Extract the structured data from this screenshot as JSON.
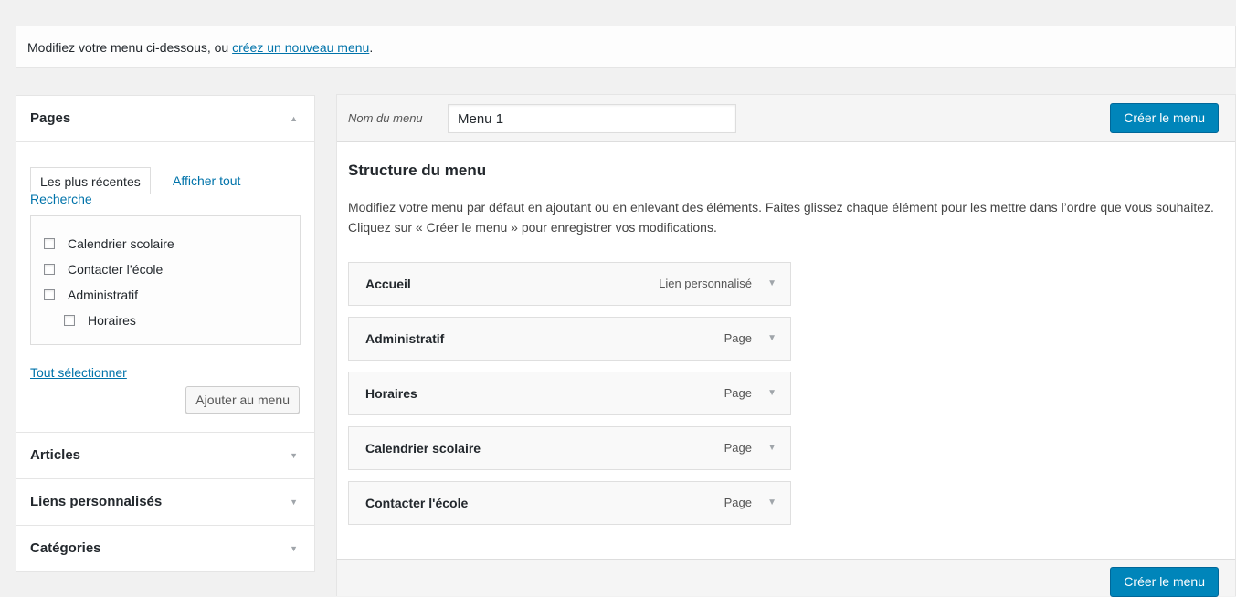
{
  "notice": {
    "text_before": "Modifiez votre menu ci-dessous, ou ",
    "link": "créez un nouveau menu",
    "text_after": "."
  },
  "left": {
    "pages": {
      "title": "Pages",
      "tabs": {
        "recent": "Les plus récentes",
        "all": "Afficher tout",
        "search": "Recherche"
      },
      "items": [
        {
          "label": "Calendrier scolaire"
        },
        {
          "label": "Contacter l’école"
        },
        {
          "label": "Administratif"
        },
        {
          "label": "Horaires"
        }
      ],
      "select_all": "Tout sélectionner",
      "add_button": "Ajouter au menu"
    },
    "sections": [
      {
        "title": "Articles"
      },
      {
        "title": "Liens personnalisés"
      },
      {
        "title": "Catégories"
      }
    ]
  },
  "menu": {
    "name_label": "Nom du menu",
    "name_value": "Menu 1",
    "create_button": "Créer le menu",
    "structure_title": "Structure du menu",
    "structure_desc": "Modifiez votre menu par défaut en ajoutant ou en enlevant des éléments. Faites glissez chaque élément pour les mettre dans l’ordre que vous souhaitez. Cliquez sur « Créer le menu » pour enregistrer vos modifications.",
    "items": [
      {
        "title": "Accueil",
        "type": "Lien personnalisé"
      },
      {
        "title": "Administratif",
        "type": "Page"
      },
      {
        "title": "Horaires",
        "type": "Page"
      },
      {
        "title": "Calendrier scolaire",
        "type": "Page"
      },
      {
        "title": "Contacter l'école",
        "type": "Page"
      }
    ],
    "footer_button": "Créer le menu"
  },
  "icons": {
    "collapse": "▲",
    "expand": "▼"
  }
}
